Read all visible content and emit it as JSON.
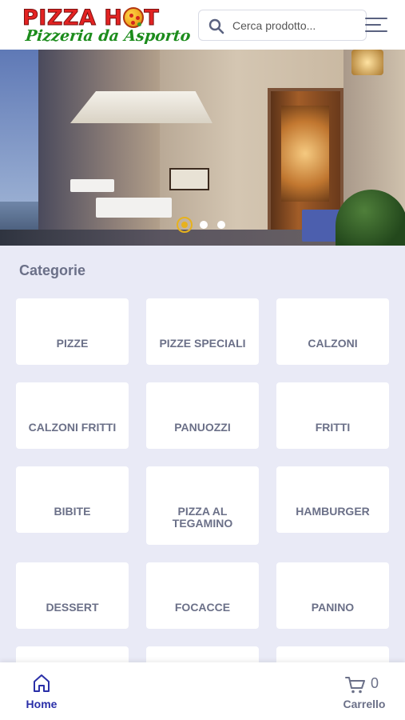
{
  "header": {
    "logo_top": "PIZZA H",
    "logo_top_end": "T",
    "logo_bottom": "Pizzeria da Asporto",
    "search_placeholder": "Cerca prodotto...",
    "menu_icon": "hamburger-menu-icon"
  },
  "hero": {
    "slides": 3,
    "active_slide": 1,
    "accent_color": "#e7b21d"
  },
  "categories": {
    "title": "Categorie",
    "items": [
      {
        "label": "PIZZE"
      },
      {
        "label": "PIZZE SPECIALI"
      },
      {
        "label": "CALZONI"
      },
      {
        "label": "CALZONI FRITTI"
      },
      {
        "label": "PANUOZZI"
      },
      {
        "label": "FRITTI"
      },
      {
        "label": "BIBITE"
      },
      {
        "label": "PIZZA AL TEGAMINO"
      },
      {
        "label": "HAMBURGER"
      },
      {
        "label": "DESSERT"
      },
      {
        "label": "FOCACCE"
      },
      {
        "label": "PANINO"
      }
    ]
  },
  "bottom_nav": {
    "home_label": "Home",
    "home_icon": "home-icon",
    "cart_label": "Carrello",
    "cart_icon": "cart-icon",
    "cart_count": "0",
    "active_color": "#2a2fa8"
  }
}
